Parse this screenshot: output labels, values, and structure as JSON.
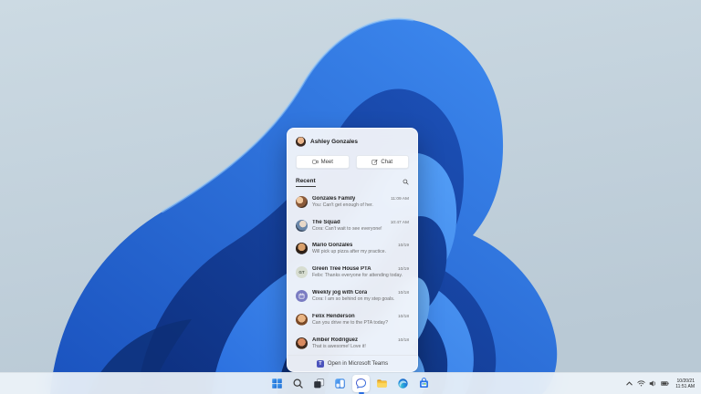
{
  "wallpaper": {
    "name": "Windows 11 Bloom",
    "accent": "#2a70dd",
    "background": "#c6d4de"
  },
  "chat_flyout": {
    "user_name": "Ashley Gonzales",
    "meet_label": "Meet",
    "chat_label": "Chat",
    "section_label": "Recent",
    "conversations": [
      {
        "name": "Gonzales Family",
        "preview": "You: Can't get enough of her.",
        "time": "11:09 AM",
        "avatar": "photo-family"
      },
      {
        "name": "The Squad",
        "preview": "Cora: Can't wait to see everyone!",
        "time": "10:47 AM",
        "avatar": "photo-group"
      },
      {
        "name": "Mario Gonzales",
        "preview": "Will pick up pizza after my practice.",
        "time": "10/19",
        "avatar": "photo-man"
      },
      {
        "name": "Green Tree House PTA",
        "preview": "Felix: Thanks everyone for attending today.",
        "time": "10/19",
        "avatar": "initials",
        "initials": "GT"
      },
      {
        "name": "Weekly jog with Cora",
        "preview": "Cora: I am so behind on my step goals.",
        "time": "10/18",
        "avatar": "calendar-icon"
      },
      {
        "name": "Felix Henderson",
        "preview": "Can you drive me to the PTA today?",
        "time": "10/18",
        "avatar": "photo-boy"
      },
      {
        "name": "Amber Rodriguez",
        "preview": "That is awesome! Love it!",
        "time": "10/18",
        "avatar": "photo-woman"
      }
    ],
    "footer_label": "Open in Microsoft Teams",
    "teams_logo_letter": "T"
  },
  "taskbar": {
    "apps": [
      "start",
      "search",
      "task-view",
      "widgets",
      "chat",
      "file-explorer",
      "edge",
      "store"
    ],
    "active_app": "chat",
    "tray": {
      "date": "10/20/21",
      "time": "11:51 AM",
      "icons": [
        "chevron-up",
        "wifi",
        "volume",
        "battery"
      ]
    }
  }
}
